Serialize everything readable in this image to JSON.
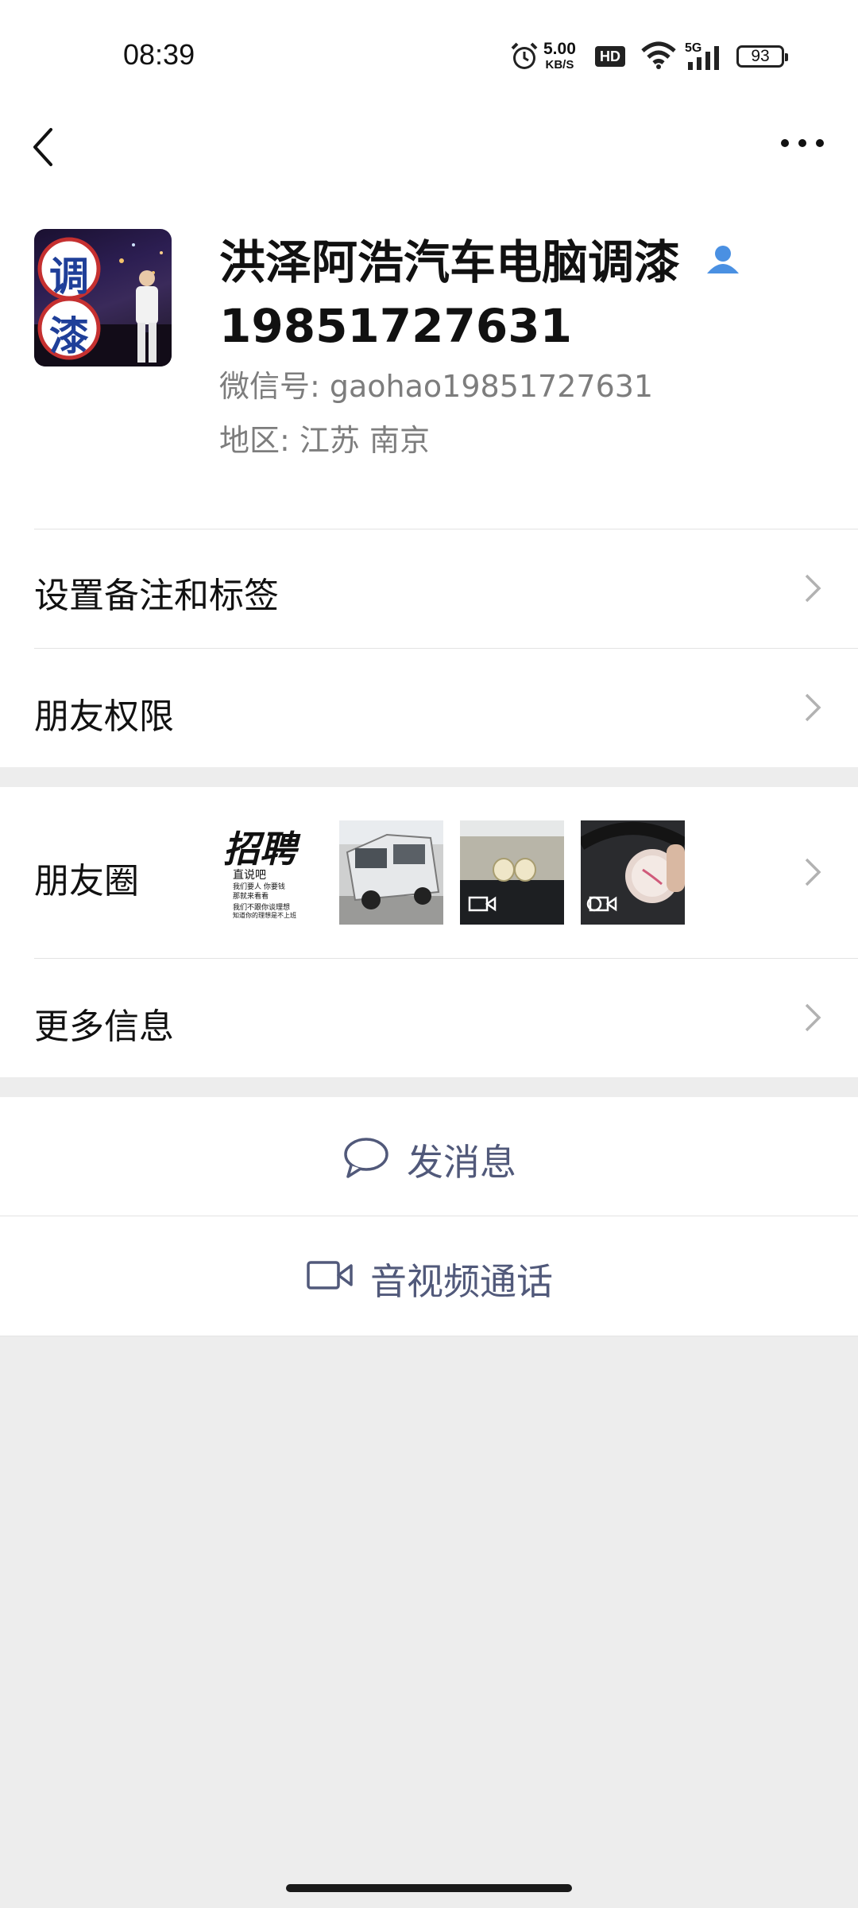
{
  "status_bar": {
    "time": "08:39",
    "net_speed_value": "5.00",
    "net_speed_unit": "KB/S",
    "hd_badge": "HD",
    "signal_label": "5G",
    "battery": "93"
  },
  "contact": {
    "name": "洪泽阿浩汽车电脑调漆19851727631",
    "wechat_id": "微信号:  gaohao19851727631",
    "region": "地区:  江苏  南京",
    "avatar_chars": [
      "调",
      "漆"
    ]
  },
  "menu": {
    "remark_label": "设置备注和标签",
    "permissions_label": "朋友权限",
    "moments_label": "朋友圈",
    "more_info_label": "更多信息"
  },
  "moments_thumb1": {
    "title": "招聘",
    "line1": "直说吧",
    "line2": "我们要人 你要钱",
    "line3": "那就来看看",
    "line4": "我们不跟你谈理想",
    "line5": "知道你的理想是不上班"
  },
  "actions": {
    "message_label": "发消息",
    "call_label": "音视频通话"
  },
  "colors": {
    "accent": "#51597a",
    "verified_icon": "#4a90e2",
    "background": "#ededed"
  }
}
